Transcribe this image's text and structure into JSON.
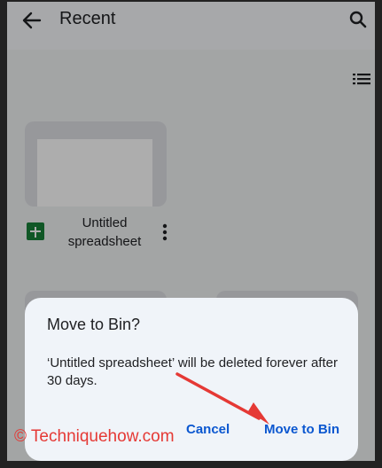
{
  "appbar": {
    "title": "Recent",
    "back_icon": "arrow-left-icon",
    "search_icon": "search-icon",
    "list_view_icon": "list-view-icon"
  },
  "file": {
    "name": "Untitled spreadsheet",
    "type_icon": "google-sheets-icon",
    "more_icon": "more-vertical-icon"
  },
  "dialog": {
    "title": "Move to Bin?",
    "message": "‘Untitled spreadsheet’ will be deleted forever after 30 days.",
    "cancel_label": "Cancel",
    "confirm_label": "Move to Bin"
  },
  "annotation": {
    "arrow_color": "#e53935"
  },
  "watermark": "© Techniquehow.com",
  "colors": {
    "accent": "#0b57d0",
    "sheets_green": "#188038"
  }
}
